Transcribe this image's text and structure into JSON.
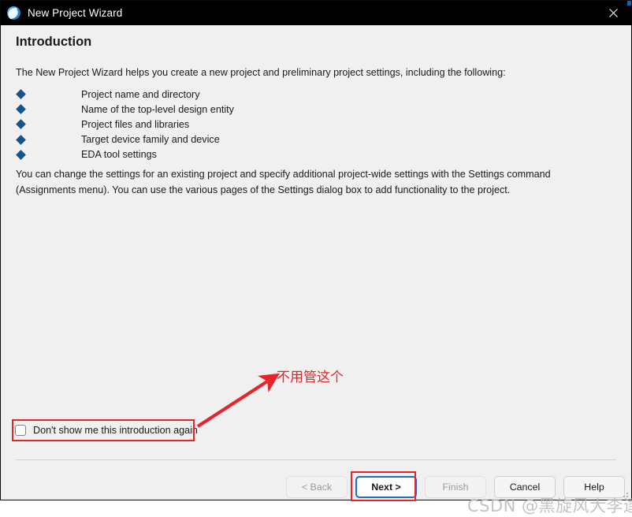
{
  "window": {
    "title": "New Project Wizard",
    "icon": "quartus-globe-icon",
    "close_label": "✕",
    "titlebar_bg": "#000000",
    "body_bg": "#f0f0f0"
  },
  "page": {
    "heading": "Introduction",
    "paragraph1": "The New Project Wizard helps you create a new project and preliminary project settings, including the following:",
    "bullets": [
      "Project name and directory",
      "Name of the top-level design entity",
      "Project files and libraries",
      "Target device family and device",
      "EDA tool settings"
    ],
    "paragraph2": "You can change the settings for an existing project and specify additional project-wide settings with the Settings command (Assignments menu). You can use the various pages of the Settings dialog box to add functionality to the project.",
    "bullet_color": "#16548c"
  },
  "checkbox": {
    "label": "Don't show me this introduction again",
    "checked": false
  },
  "footer": {
    "buttons": [
      {
        "label": "< Back",
        "state": "disabled"
      },
      {
        "label": "Next >",
        "state": "default"
      },
      {
        "label": "Finish",
        "state": "disabled"
      },
      {
        "label": "Cancel",
        "state": "enabled"
      },
      {
        "label": "Help",
        "state": "enabled"
      }
    ]
  },
  "annotations": {
    "note_text": "不用管这个",
    "color": "#e8232a",
    "highlight_targets": [
      "checkbox-row",
      "next-button"
    ]
  },
  "watermark": {
    "text": "CSDN @黑旋风大李逵",
    "color": "#b9b9b9"
  }
}
